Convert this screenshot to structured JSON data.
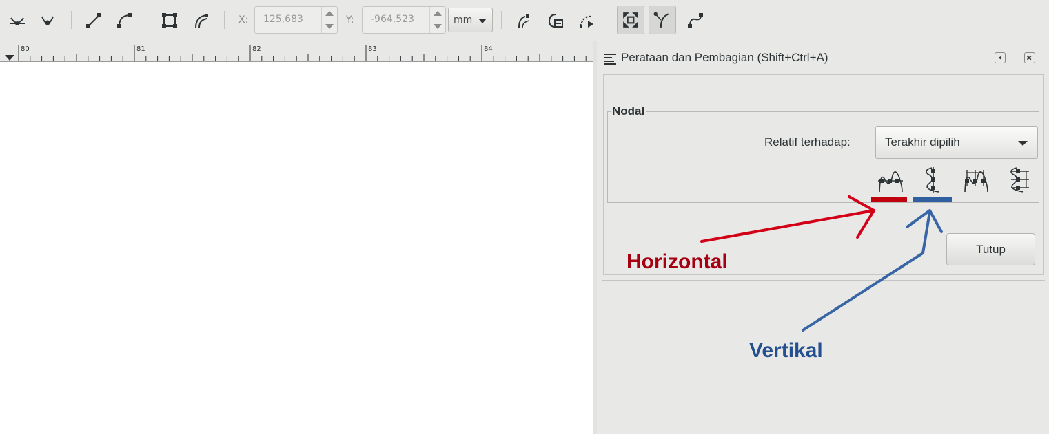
{
  "toolbar": {
    "x_label": "X:",
    "x_value": "125,683",
    "y_label": "Y:",
    "y_value": "-964,523",
    "unit": "mm",
    "icons": [
      "make-selected-nodes-symmetric-icon",
      "make-selected-nodes-auto-smooth-icon",
      "make-segments-lines-icon",
      "make-segments-curves-icon",
      "convert-object-to-path-icon",
      "convert-stroke-to-path-icon",
      "next-path-effect-parameter-icon",
      "clip-path-icon",
      "mask-icon",
      "show-transform-handles-icon",
      "show-bezier-handles-icon",
      "show-path-outline-icon"
    ]
  },
  "ruler": {
    "labels": [
      "80",
      "81",
      "82",
      "83",
      "84"
    ]
  },
  "dock": {
    "title": "Perataan dan Pembagian (Shift+Ctrl+A)",
    "section_label": "Nodal",
    "relative_label": "Relatif terhadap:",
    "relative_value": "Terakhir dipilih",
    "node_buttons": [
      "align-nodes-horizontal-icon",
      "align-nodes-vertical-icon",
      "distribute-nodes-horizontal-icon",
      "distribute-nodes-vertical-icon"
    ],
    "close_label": "Tutup"
  },
  "annotations": {
    "horizontal_label": "Horizontal",
    "vertical_label": "Vertikal",
    "horizontal_color": "#c0000c",
    "vertical_color": "#2f5f9f"
  }
}
